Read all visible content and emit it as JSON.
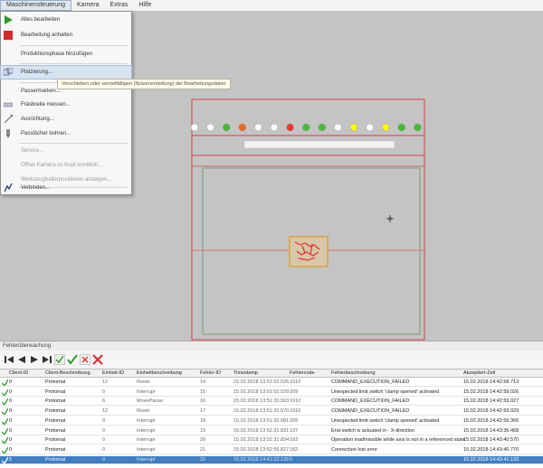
{
  "menubar": [
    "Maschinensteuerung",
    "Kamera",
    "Extras",
    "Hilfe"
  ],
  "menu": {
    "items": [
      {
        "label": "Alles bearbeiten",
        "icon": "play-icon",
        "disabled": false
      },
      {
        "label": "Bearbeitung anhalten",
        "icon": "stop-icon",
        "disabled": false
      },
      {
        "label": "Produktionsphase hinzufügen",
        "icon": "",
        "disabled": false
      },
      {
        "label": "Platzierung...",
        "icon": "placement-icon",
        "disabled": false,
        "highlighted": true
      },
      {
        "label": "Passermarken...",
        "icon": "",
        "disabled": false
      },
      {
        "label": "Fräsbreite messen...",
        "icon": "measure-icon",
        "disabled": false
      },
      {
        "label": "Ausrichtung...",
        "icon": "align-icon",
        "disabled": false
      },
      {
        "label": "Passlöcher bohren...",
        "icon": "drill-icon",
        "disabled": false
      },
      {
        "label": "Service...",
        "icon": "",
        "disabled": true
      },
      {
        "label": "Offset Kamera zu Kopf ermitteln...",
        "icon": "",
        "disabled": true
      },
      {
        "label": "Werkzeughalterpositionen anzeigen...",
        "icon": "",
        "disabled": true
      },
      {
        "label": "Verbinden...",
        "icon": "connect-icon",
        "disabled": false
      }
    ],
    "tooltip": "Verschieben oder vervielfältigen (Nutzenerstellung) der Bearbeitungsdaten"
  },
  "canvas": {
    "indicator_colors": [
      "#ffffff",
      "#ffffff",
      "#44bb33",
      "#ee6622",
      "#ffffff",
      "#ffffff",
      "#ee3333",
      "#44bb33",
      "#44bb33",
      "#ffffff",
      "#ffff00",
      "#ffffff",
      "#ffff00",
      "#44bb33",
      "#44bb33"
    ]
  },
  "errors": {
    "panel_title": "Fehlerüberwachung",
    "headers": [
      "Client-ID",
      "Client-Beschreibung",
      "Einheit-ID",
      "Einheitbeschreibung",
      "Fehler-ID",
      "Timestamp",
      "Fehlercode",
      "Fehlerbeschreibung",
      "Akzeptiert-Zeit"
    ],
    "rows": [
      [
        "0",
        "Protomat",
        "12",
        "Reset",
        "14",
        "15.02.2018 13:51:02.526",
        "1910",
        "COMMAND_EXECUTION_FAILED",
        "15.02.2018 14:42:58.713"
      ],
      [
        "0",
        "Protomat",
        "0",
        "Interrupt",
        "15",
        "15.02.2018 13:51:02.529",
        "209",
        "Unexpected limit switch 'clamp opened' activated",
        "15.02.2018 14:42:59.026"
      ],
      [
        "0",
        "Protomat",
        "6",
        "MovePause",
        "16",
        "15.02.2018 13:51:20.563",
        "1910",
        "COMMAND_EXECUTION_FAILED",
        "15.02.2018 14:42:59.027"
      ],
      [
        "0",
        "Protomat",
        "12",
        "Reset",
        "17",
        "15.02.2018 13:51:20.570",
        "1910",
        "COMMAND_EXECUTION_FAILED",
        "15.02.2018 14:42:59.029"
      ],
      [
        "0",
        "Protomat",
        "0",
        "Interrupt",
        "18",
        "15.02.2018 13:51:20.581",
        "209",
        "Unexpected limit switch 'clamp opened' activated",
        "15.02.2018 14:42:59.365"
      ],
      [
        "0",
        "Protomat",
        "0",
        "Interrupt",
        "19",
        "15.02.2018 13:52:31.831",
        "137",
        "End-switch is actuated in - X-direction",
        "15.02.2018 14:43:36.468"
      ],
      [
        "0",
        "Protomat",
        "0",
        "Interrupt",
        "20",
        "15.02.2018 13:52:31.834",
        "193",
        "Operation inadmissible while axis is not in a referenced state",
        "15.02.2018 14:43:40.570"
      ],
      [
        "0",
        "Protomat",
        "0",
        "Interrupt",
        "21",
        "15.02.2018 13:52:56.827",
        "182",
        "Connection lost error",
        "15.02.2018 14:43:40.770"
      ],
      [
        "5",
        "Protomat",
        "0",
        "Interrupt",
        "22",
        "15.02.2018 14:41:23.135",
        "5",
        "",
        "15.02.2018 14:43:41.133"
      ]
    ]
  }
}
